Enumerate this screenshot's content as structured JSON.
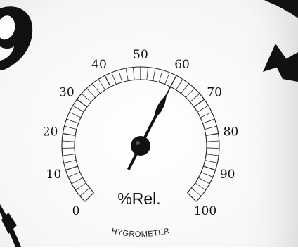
{
  "photo": {
    "scale_labels": [
      "0",
      "10",
      "20",
      "30",
      "40",
      "50",
      "60",
      "70",
      "80",
      "90",
      "100"
    ],
    "unit_label": "%Rel.",
    "device_label": "HYGROMETER",
    "reading_percent": 60
  }
}
